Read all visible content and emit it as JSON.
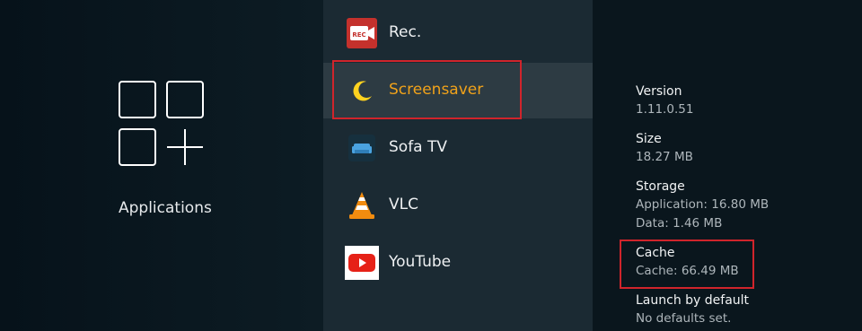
{
  "left": {
    "title": "Applications"
  },
  "apps": [
    {
      "label": "Rec.",
      "icon": "rec-app-icon",
      "icon_text": "REC"
    },
    {
      "label": "Screensaver",
      "icon": "moon-icon",
      "selected": true
    },
    {
      "label": "Sofa TV",
      "icon": "sofa-tv-icon"
    },
    {
      "label": "VLC",
      "icon": "vlc-cone-icon"
    },
    {
      "label": "YouTube",
      "icon": "youtube-icon"
    }
  ],
  "info": {
    "version": {
      "title": "Version",
      "value": "1.11.0.51"
    },
    "size": {
      "title": "Size",
      "value": "18.27 MB"
    },
    "storage": {
      "title": "Storage",
      "application": "Application: 16.80 MB",
      "data": "Data: 1.46 MB"
    },
    "cache": {
      "title": "Cache",
      "value": "Cache: 66.49 MB"
    },
    "launch": {
      "title": "Launch by default",
      "value": "No defaults set."
    }
  },
  "colors": {
    "accent": "#f0a21a",
    "highlight": "#d0242b",
    "selected_bg": "#2d3b43"
  }
}
